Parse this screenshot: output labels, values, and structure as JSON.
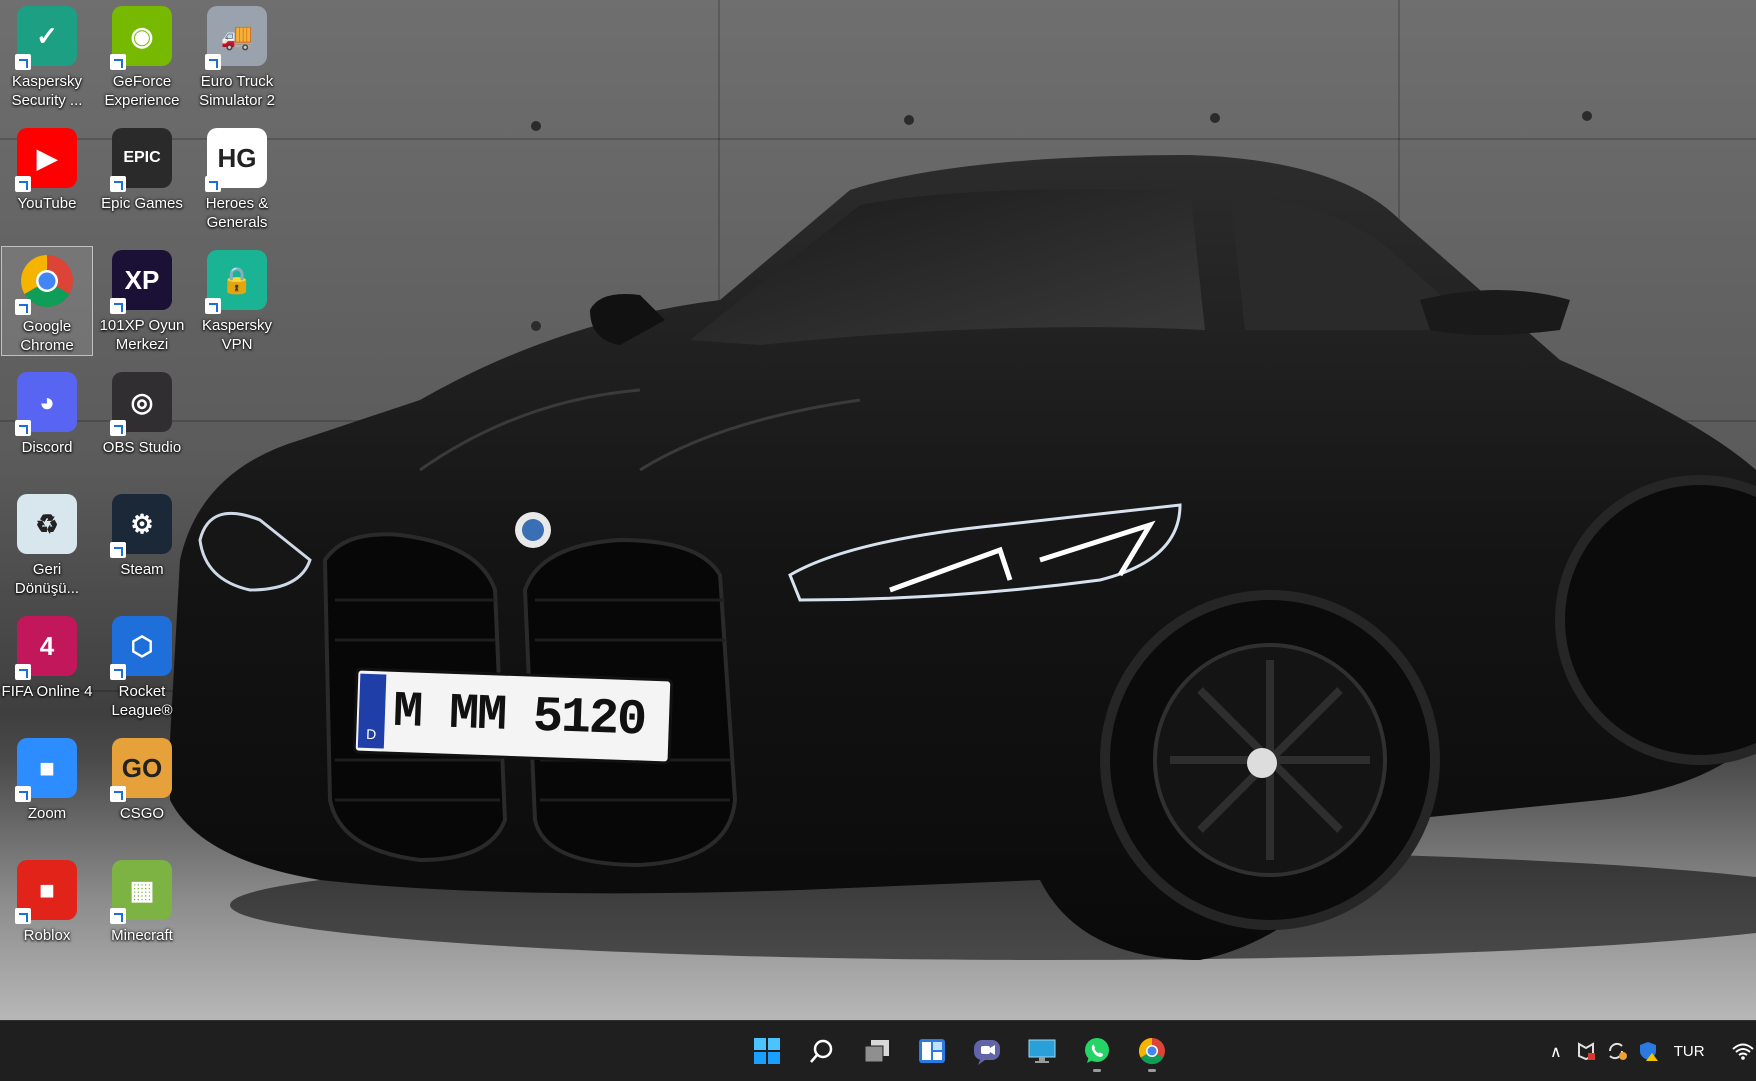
{
  "desktop": {
    "icons": [
      {
        "label": "Kaspersky Security ...",
        "icon": "kaspersky-security-icon",
        "color": "#1d9f83"
      },
      {
        "label": "GeForce Experience",
        "icon": "geforce-experience-icon",
        "color": "#76b900"
      },
      {
        "label": "Euro Truck Simulator 2",
        "icon": "euro-truck-simulator-icon",
        "color": "#9aa3ad"
      },
      {
        "label": "YouTube",
        "icon": "youtube-icon",
        "color": "#ff0000"
      },
      {
        "label": "Epic Games",
        "icon": "epic-games-icon",
        "color": "#2a2a2a"
      },
      {
        "label": "Heroes & Generals",
        "icon": "heroes-generals-icon",
        "color": "#ffffff"
      },
      {
        "label": "Google Chrome",
        "icon": "google-chrome-icon",
        "color": "#4285f4"
      },
      {
        "label": "101XP Oyun Merkezi",
        "icon": "101xp-icon",
        "color": "#1b1035"
      },
      {
        "label": "Kaspersky VPN",
        "icon": "kaspersky-vpn-icon",
        "color": "#1ab394"
      },
      {
        "label": "Discord",
        "icon": "discord-icon",
        "color": "#5865f2"
      },
      {
        "label": "OBS Studio",
        "icon": "obs-studio-icon",
        "color": "#302e31"
      },
      {
        "label": "Geri Dönüşü...",
        "icon": "recycle-bin-icon",
        "color": "#d8e6ee"
      },
      {
        "label": "Steam",
        "icon": "steam-icon",
        "color": "#1b2838"
      },
      {
        "label": "FIFA Online 4",
        "icon": "fifa-online-icon",
        "color": "#c2185b"
      },
      {
        "label": "Rocket League®",
        "icon": "rocket-league-icon",
        "color": "#1e6fd9"
      },
      {
        "label": "Zoom",
        "icon": "zoom-icon",
        "color": "#2d8cff"
      },
      {
        "label": "CSGO",
        "icon": "csgo-icon",
        "color": "#e7a13a"
      },
      {
        "label": "Roblox",
        "icon": "roblox-icon",
        "color": "#e2231a"
      },
      {
        "label": "Minecraft",
        "icon": "minecraft-icon",
        "color": "#7cb342"
      }
    ],
    "selected": "Google Chrome",
    "wallpaper_plate": "M MM 5120",
    "wallpaper_plate_country": "D"
  },
  "taskbar": {
    "apps": [
      {
        "icon": "windows-start-icon"
      },
      {
        "icon": "search-icon"
      },
      {
        "icon": "task-view-icon"
      },
      {
        "icon": "widgets-icon"
      },
      {
        "icon": "teams-chat-icon"
      },
      {
        "icon": "desktop-monitor-icon"
      },
      {
        "icon": "whatsapp-icon"
      },
      {
        "icon": "google-chrome-icon"
      }
    ],
    "tray": {
      "language": "TUR"
    }
  }
}
